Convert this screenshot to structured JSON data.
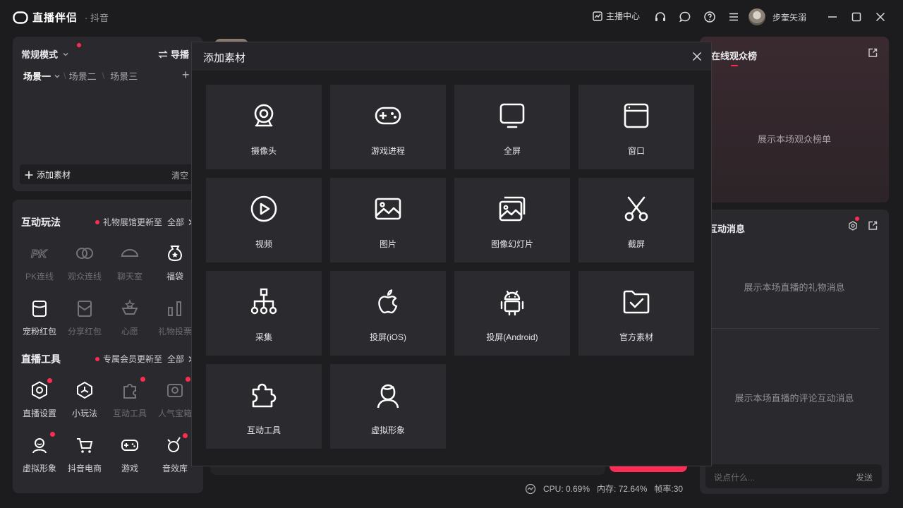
{
  "app": {
    "brand": "直播伴侣",
    "platform": "· 抖音"
  },
  "titlebar": {
    "anchor_center": "主播中心",
    "username": "步奎矢溺"
  },
  "scene_panel": {
    "mode": "常规模式",
    "guide": "导播",
    "scenes": [
      "场景一",
      "场景二",
      "场景三"
    ],
    "add_source": "添加素材",
    "clear": "清空"
  },
  "interactive": {
    "title": "互动玩法",
    "update_tip": "礼物展馆更新至",
    "all": "全部",
    "items": [
      {
        "label": "PK连线",
        "icon": "pk-icon",
        "dim": true
      },
      {
        "label": "观众连线",
        "icon": "audience-link-icon",
        "dim": true
      },
      {
        "label": "聊天室",
        "icon": "chatroom-icon",
        "dim": true
      },
      {
        "label": "福袋",
        "icon": "lucky-bag-icon",
        "dim": false
      },
      {
        "label": "宠粉红包",
        "icon": "fan-redpacket-icon",
        "dim": false
      },
      {
        "label": "分享红包",
        "icon": "share-redpacket-icon",
        "dim": true
      },
      {
        "label": "心愿",
        "icon": "wish-icon",
        "dim": true
      },
      {
        "label": "礼物投票",
        "icon": "gift-vote-icon",
        "dim": true
      }
    ]
  },
  "live_tools": {
    "title": "直播工具",
    "update_tip": "专属会员更新至",
    "all": "全部",
    "items": [
      {
        "label": "直播设置",
        "icon": "live-settings-icon",
        "dim": false,
        "dot": true
      },
      {
        "label": "小玩法",
        "icon": "mini-game-icon",
        "dim": false,
        "dot": false
      },
      {
        "label": "互动工具",
        "icon": "puzzle-icon",
        "dim": true,
        "dot": true
      },
      {
        "label": "人气宝箱",
        "icon": "treasure-icon",
        "dim": true,
        "dot": true
      },
      {
        "label": "虚拟形象",
        "icon": "avatar-icon",
        "dim": false,
        "dot": true
      },
      {
        "label": "抖音电商",
        "icon": "cart-icon",
        "dim": false,
        "dot": false
      },
      {
        "label": "游戏",
        "icon": "gamepad-icon",
        "dim": false,
        "dot": false
      },
      {
        "label": "音效库",
        "icon": "sound-library-icon",
        "dim": false,
        "dot": true
      }
    ]
  },
  "rank_panel": {
    "title": "在线观众榜",
    "placeholder": "展示本场观众榜单"
  },
  "msg_panel": {
    "title": "互动消息",
    "gift_placeholder": "展示本场直播的礼物消息",
    "comment_placeholder": "展示本场直播的评论互动消息"
  },
  "chat": {
    "placeholder": "说点什么...",
    "send": "发送"
  },
  "modal": {
    "title": "添加素材",
    "tiles": [
      {
        "label": "摄像头",
        "icon": "camera-icon"
      },
      {
        "label": "游戏进程",
        "icon": "game-process-icon"
      },
      {
        "label": "全屏",
        "icon": "fullscreen-icon"
      },
      {
        "label": "窗口",
        "icon": "window-icon"
      },
      {
        "label": "视频",
        "icon": "video-icon"
      },
      {
        "label": "图片",
        "icon": "image-icon"
      },
      {
        "label": "图像幻灯片",
        "icon": "slideshow-icon"
      },
      {
        "label": "截屏",
        "icon": "screenshot-icon"
      },
      {
        "label": "采集",
        "icon": "capture-icon"
      },
      {
        "label": "投屏(iOS)",
        "icon": "ios-cast-icon"
      },
      {
        "label": "投屏(Android)",
        "icon": "android-cast-icon"
      },
      {
        "label": "官方素材",
        "icon": "official-material-icon"
      },
      {
        "label": "互动工具",
        "icon": "interactive-tool-icon"
      },
      {
        "label": "虚拟形象",
        "icon": "virtual-avatar-icon"
      }
    ]
  },
  "status": {
    "cpu": "CPU: 0.69%",
    "memory": "内存: 72.64%",
    "fps": "帧率:30"
  },
  "colors": {
    "accent": "#fe2c55",
    "background": "#1c1c1f",
    "panel": "#2a2a2e",
    "tile": "#2b2b2f"
  }
}
